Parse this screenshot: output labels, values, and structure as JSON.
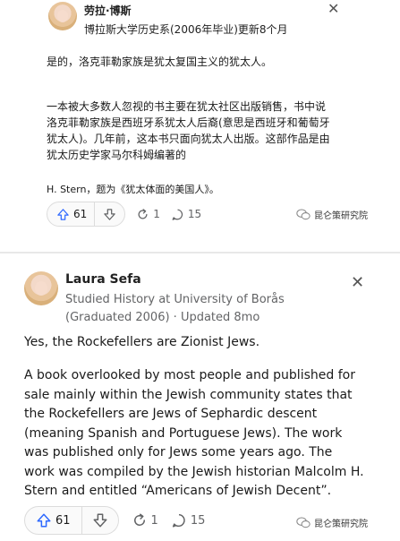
{
  "translated_answer": {
    "author_name": "劳拉·博斯",
    "credential": "博拉斯大学历史系(2006年毕业)更新8个月",
    "paragraph_1": "是的，洛克菲勒家族是犹太复国主义的犹太人。",
    "paragraph_2": "一本被大多数人忽视的书主要在犹太社区出版销售，书中说洛克菲勒家族是西班牙系犹太人后裔(意思是西班牙和葡萄牙犹太人)。几年前，这本书只面向犹太人出版。这部作品是由犹太历史学家马尔科姆编著的",
    "paragraph_3": "H. Stern，题为《犹太体面的美国人》。",
    "upvotes": "61",
    "shares": "1",
    "comments": "15",
    "watermark": "昆仑策研究院"
  },
  "original_answer": {
    "author_name": "Laura Sefa",
    "credential": "Studied History at University of Borås (Graduated 2006) · Updated 8mo",
    "paragraph_1": "Yes, the Rockefellers are Zionist Jews.",
    "paragraph_2": "A book overlooked by most people and published for sale mainly within the Jewish community states that the Rockefellers are Jews of Sephardic descent (meaning Spanish and Portuguese Jews). The work was published only for Jews some years ago. The work was compiled by the Jewish historian Malcolm H. Stern and entitled “Americans of Jewish Decent”.",
    "upvotes": "61",
    "shares": "1",
    "comments": "15",
    "watermark": "昆仑策研究院"
  },
  "icons": {
    "close": "close-icon",
    "upvote": "upvote-icon",
    "downvote": "downvote-icon",
    "share": "share-icon",
    "comment": "comment-icon",
    "watermark": "wechat-icon"
  },
  "colors": {
    "upvote_accent": "#2e69ff",
    "muted_text": "#636466"
  }
}
